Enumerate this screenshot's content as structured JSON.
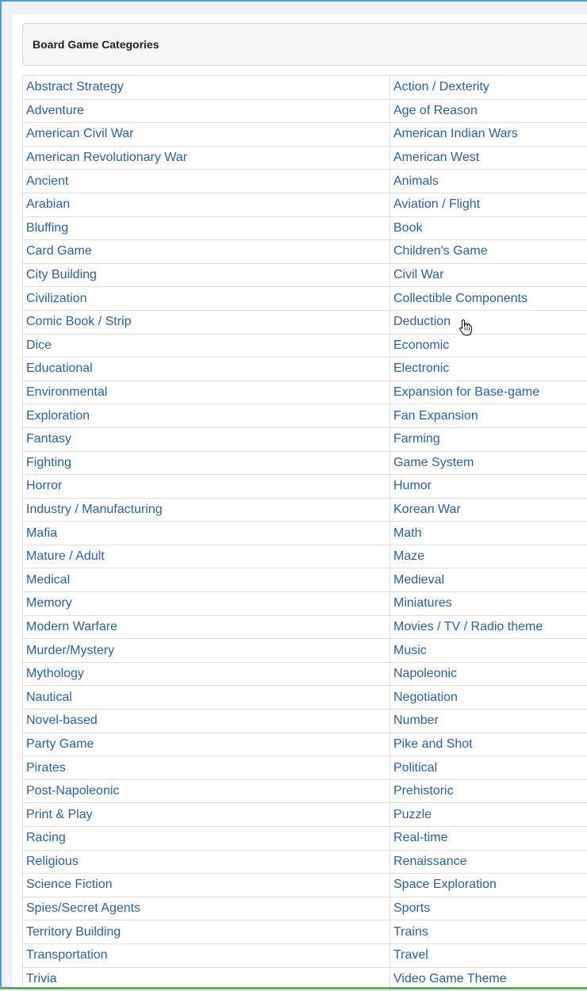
{
  "panel": {
    "title": "Board Game Categories"
  },
  "categories": [
    [
      "Abstract Strategy",
      "Action / Dexterity"
    ],
    [
      "Adventure",
      "Age of Reason"
    ],
    [
      "American Civil War",
      "American Indian Wars"
    ],
    [
      "American Revolutionary War",
      "American West"
    ],
    [
      "Ancient",
      "Animals"
    ],
    [
      "Arabian",
      "Aviation / Flight"
    ],
    [
      "Bluffing",
      "Book"
    ],
    [
      "Card Game",
      "Children's Game"
    ],
    [
      "City Building",
      "Civil War"
    ],
    [
      "Civilization",
      "Collectible Components"
    ],
    [
      "Comic Book / Strip",
      "Deduction"
    ],
    [
      "Dice",
      "Economic"
    ],
    [
      "Educational",
      "Electronic"
    ],
    [
      "Environmental",
      "Expansion for Base-game"
    ],
    [
      "Exploration",
      "Fan Expansion"
    ],
    [
      "Fantasy",
      "Farming"
    ],
    [
      "Fighting",
      "Game System"
    ],
    [
      "Horror",
      "Humor"
    ],
    [
      "Industry / Manufacturing",
      "Korean War"
    ],
    [
      "Mafia",
      "Math"
    ],
    [
      "Mature / Adult",
      "Maze"
    ],
    [
      "Medical",
      "Medieval"
    ],
    [
      "Memory",
      "Miniatures"
    ],
    [
      "Modern Warfare",
      "Movies / TV / Radio theme"
    ],
    [
      "Murder/Mystery",
      "Music"
    ],
    [
      "Mythology",
      "Napoleonic"
    ],
    [
      "Nautical",
      "Negotiation"
    ],
    [
      "Novel-based",
      "Number"
    ],
    [
      "Party Game",
      "Pike and Shot"
    ],
    [
      "Pirates",
      "Political"
    ],
    [
      "Post-Napoleonic",
      "Prehistoric"
    ],
    [
      "Print & Play",
      "Puzzle"
    ],
    [
      "Racing",
      "Real-time"
    ],
    [
      "Religious",
      "Renaissance"
    ],
    [
      "Science Fiction",
      "Space Exploration"
    ],
    [
      "Spies/Secret Agents",
      "Sports"
    ],
    [
      "Territory Building",
      "Trains"
    ],
    [
      "Transportation",
      "Travel"
    ],
    [
      "Trivia",
      "Video Game Theme"
    ]
  ],
  "colors": {
    "link": "#2a5fb0",
    "frame_border": "#4a9be0",
    "bottom_accent": "#3fbf3f"
  },
  "icons": {
    "cursor": "hand-pointer-icon"
  }
}
